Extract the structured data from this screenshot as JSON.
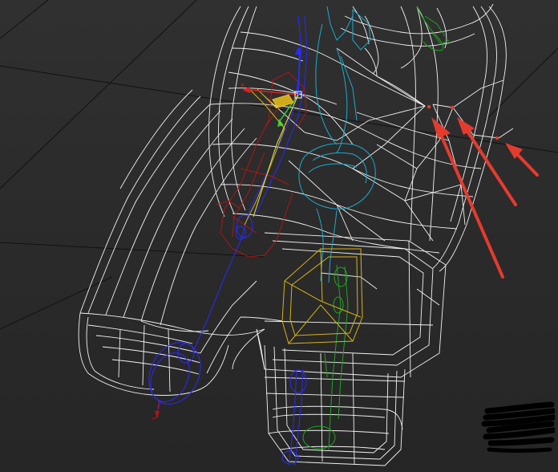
{
  "viewport": {
    "background": "#2d2d2d",
    "grid_color": "#111111",
    "mesh_color": "#ffffff",
    "arrow_color": "#e53b2f"
  },
  "gizmo": {
    "x_axis_label": "x",
    "x_color": "#e0201a",
    "y_color": "#33cc33",
    "z_color": "#2233ff",
    "plane_color": "#e8c21a"
  },
  "bones": {
    "blue": "#2a2aff",
    "cyan": "#1aaccc",
    "green": "#1fa61f",
    "red": "#b01515",
    "yellow": "#d6b21a"
  },
  "annotation_arrows_count": 3,
  "scribble_icon": "redacted-scribble-icon"
}
